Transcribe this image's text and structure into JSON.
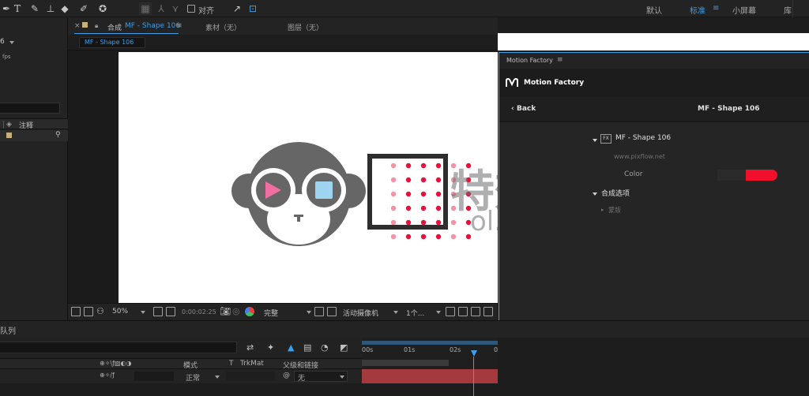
{
  "toolbar": {
    "align_label": "对齐",
    "workspaces": [
      {
        "label": "默认",
        "active": false
      },
      {
        "label": "标准",
        "active": true
      },
      {
        "label": "小屏幕",
        "active": false
      },
      {
        "label": "库",
        "active": false
      }
    ]
  },
  "left_panel": {
    "value1": "6",
    "fps_text": "fps",
    "column_comment": "注释"
  },
  "comp_panel": {
    "tab_prefix": "合成",
    "tab_name": "MF - Shape 106",
    "footage_tab": "素材（无）",
    "layer_tab": "图层（无）",
    "comp_pill": "MF - Shape 106",
    "watermark_chars": "特效",
    "watermark_url": "ol.com"
  },
  "viewer_bar": {
    "zoom": "50%",
    "timecode": "0:00:02:25",
    "resolution": "完整",
    "camera": "活动摄像机",
    "views": "1个..."
  },
  "motion_factory": {
    "panel_title": "Motion Factory",
    "brand_name": "Motion Factory",
    "back_label": "Back",
    "current_item": "MF - Shape 106",
    "fx_badge": "FX",
    "fx_item": "MF - Shape 106",
    "website": "www.pixflow.net",
    "color_label": "Color",
    "color_value": "#f0102c",
    "compositing_options": "合成选项",
    "sub_option": "蒙版"
  },
  "timeline": {
    "tab_label": "队列",
    "col_mode": "模式",
    "col_t": "T",
    "col_trkmat": "TrkMat",
    "col_parent": "父级和链接",
    "row_mode": "正常",
    "row_parent": "无",
    "ruler_ticks": [
      "00s",
      "01s",
      "02s",
      "0"
    ]
  },
  "colors": {
    "accent_blue": "#3f9ee8",
    "monkey_gray": "#666666",
    "dot_red": "#e8103a",
    "track_red": "#a43a3e"
  }
}
